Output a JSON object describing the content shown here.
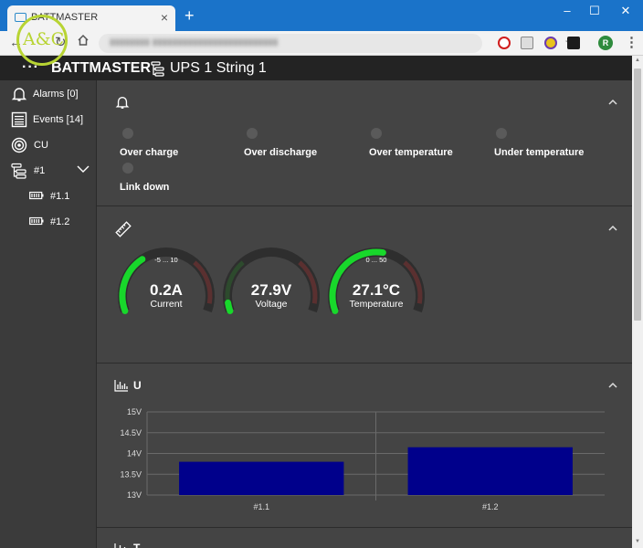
{
  "browser": {
    "tab_title": "BATTMASTER",
    "new_tab": "+",
    "minimize": "–",
    "maximize": "☐",
    "close": "✕",
    "tab_close": "×",
    "profile_initial": "R"
  },
  "header": {
    "menu_dots": "···",
    "brand": "BATTMASTER",
    "location": "UPS 1 String 1"
  },
  "logo": {
    "text": "A&C"
  },
  "sidebar": {
    "items": [
      {
        "label": "Alarms [0]",
        "icon": "bell-icon"
      },
      {
        "label": "Events [14]",
        "icon": "list-icon"
      },
      {
        "label": "CU",
        "icon": "target-icon"
      },
      {
        "label": "#1",
        "icon": "tree-icon"
      },
      {
        "label": "#1.1",
        "icon": "battery-icon"
      },
      {
        "label": "#1.2",
        "icon": "battery-icon"
      }
    ]
  },
  "alarms": {
    "items": [
      {
        "label": "Over charge",
        "active": false
      },
      {
        "label": "Over discharge",
        "active": false
      },
      {
        "label": "Over temperature",
        "active": false
      },
      {
        "label": "Under temperature",
        "active": false
      },
      {
        "label": "Link down",
        "active": false
      }
    ]
  },
  "gauges": [
    {
      "range": "-5 ... 10",
      "value": "0.2A",
      "label": "Current",
      "fill": 0.35,
      "color_fill": "#18d82b"
    },
    {
      "range": "",
      "value": "27.9V",
      "label": "Voltage",
      "fill": 0.05,
      "color_fill": "#18d82b"
    },
    {
      "range": "0 ... 50",
      "value": "27.1°C",
      "label": "Temperature",
      "fill": 0.54,
      "color_fill": "#18d82b"
    }
  ],
  "chart_panel": {
    "title": "U",
    "next_title": "T"
  },
  "chart_data": {
    "type": "bar",
    "title": "U",
    "categories": [
      "#1.1",
      "#1.2"
    ],
    "values": [
      13.8,
      14.15
    ],
    "ylim": [
      13,
      15
    ],
    "yticks": [
      "13V",
      "13.5V",
      "14V",
      "14.5V",
      "15V"
    ],
    "ytick_values": [
      13,
      13.5,
      14,
      14.5,
      15
    ],
    "grid": true,
    "bar_color": "#00008b"
  }
}
